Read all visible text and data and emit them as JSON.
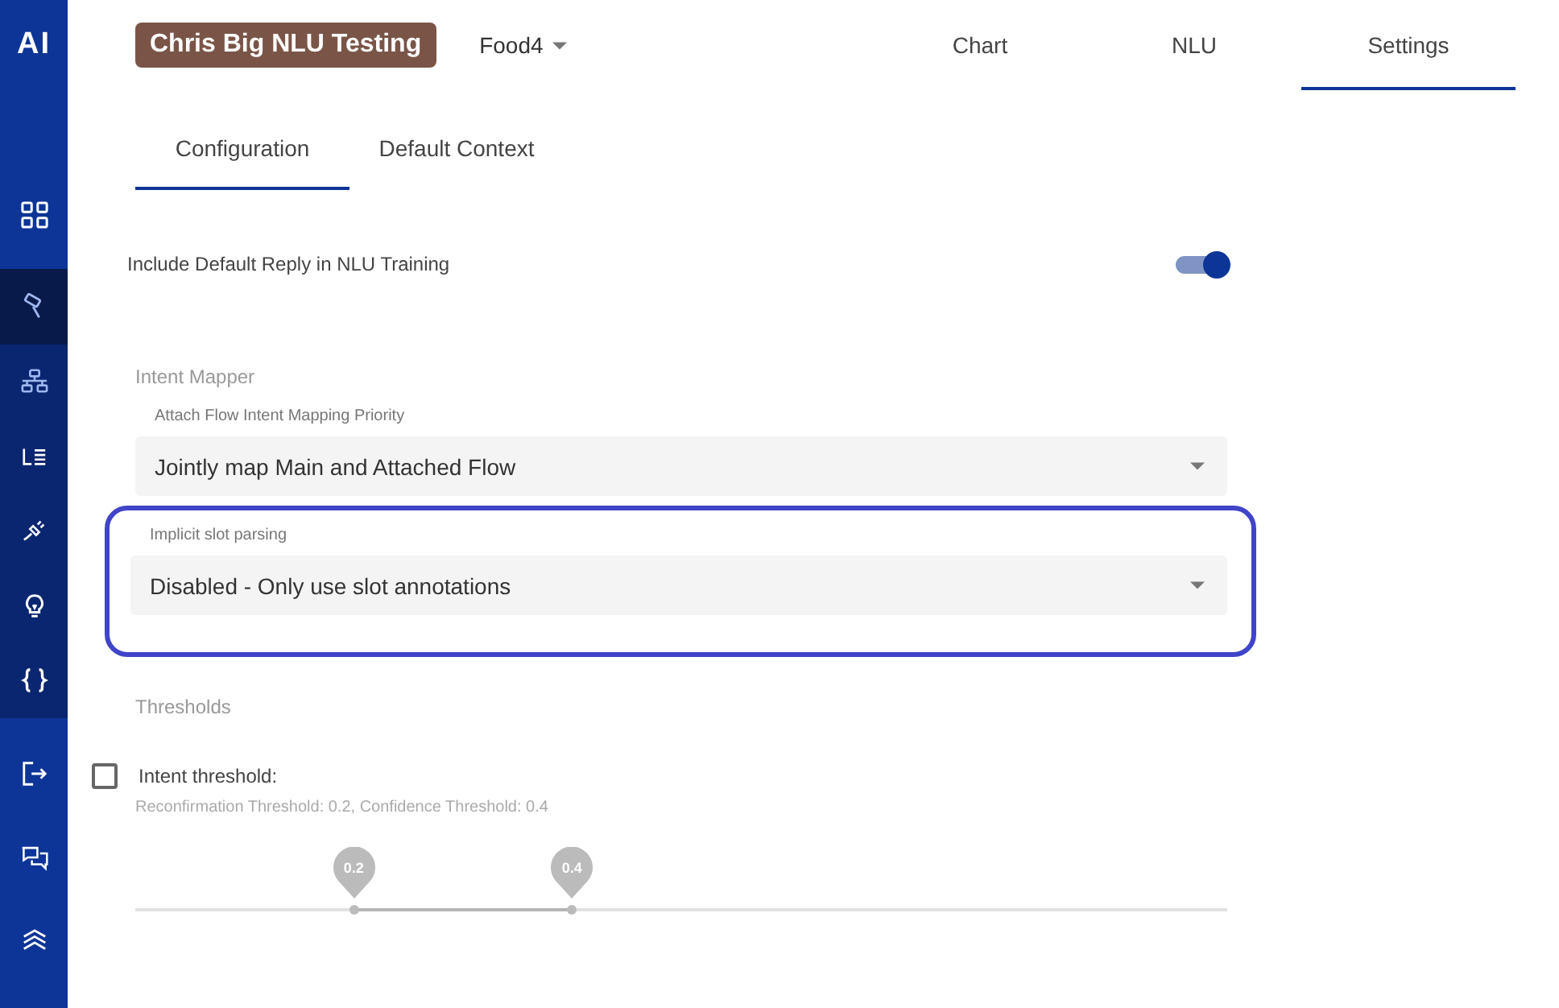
{
  "sidebar": {
    "logo": "AI",
    "top_items": [
      {
        "kind": "grid",
        "selected": false
      }
    ],
    "project_items": [
      {
        "kind": "brush",
        "selected": true
      },
      {
        "kind": "sitemap",
        "selected": false
      },
      {
        "kind": "list",
        "selected": false
      },
      {
        "kind": "plug",
        "selected": false
      },
      {
        "kind": "bulb",
        "selected": false
      },
      {
        "kind": "braces",
        "selected": false
      }
    ],
    "bottom_items": [
      {
        "kind": "exit",
        "selected": false
      },
      {
        "kind": "chat",
        "selected": false
      },
      {
        "kind": "layers",
        "selected": false
      }
    ]
  },
  "header": {
    "project": "Chris Big NLU Testing",
    "flow": "Food4",
    "tabs": [
      {
        "label": "Chart",
        "selected": false
      },
      {
        "label": "NLU",
        "selected": false
      },
      {
        "label": "Settings",
        "selected": true
      }
    ]
  },
  "subtabs": [
    {
      "label": "Configuration",
      "selected": true
    },
    {
      "label": "Default Context",
      "selected": false
    }
  ],
  "toggle": {
    "label": "Include Default Reply in NLU Training",
    "on": true
  },
  "intent_mapper": {
    "title": "Intent Mapper",
    "fields": [
      {
        "label": "Attach Flow Intent Mapping Priority",
        "value": "Jointly map Main and Attached Flow",
        "highlighted": false
      },
      {
        "label": "Implicit slot parsing",
        "value": "Disabled - Only use slot annotations",
        "highlighted": true
      }
    ]
  },
  "thresholds": {
    "title": "Thresholds",
    "checkbox": {
      "label": "Intent threshold:",
      "checked": false
    },
    "description": "Reconfirmation Threshold: 0.2, Confidence Threshold: 0.4",
    "slider": {
      "thumbs": [
        {
          "label": "0.2",
          "level": 0.2
        },
        {
          "label": "0.4",
          "level": 0.4
        }
      ]
    }
  }
}
